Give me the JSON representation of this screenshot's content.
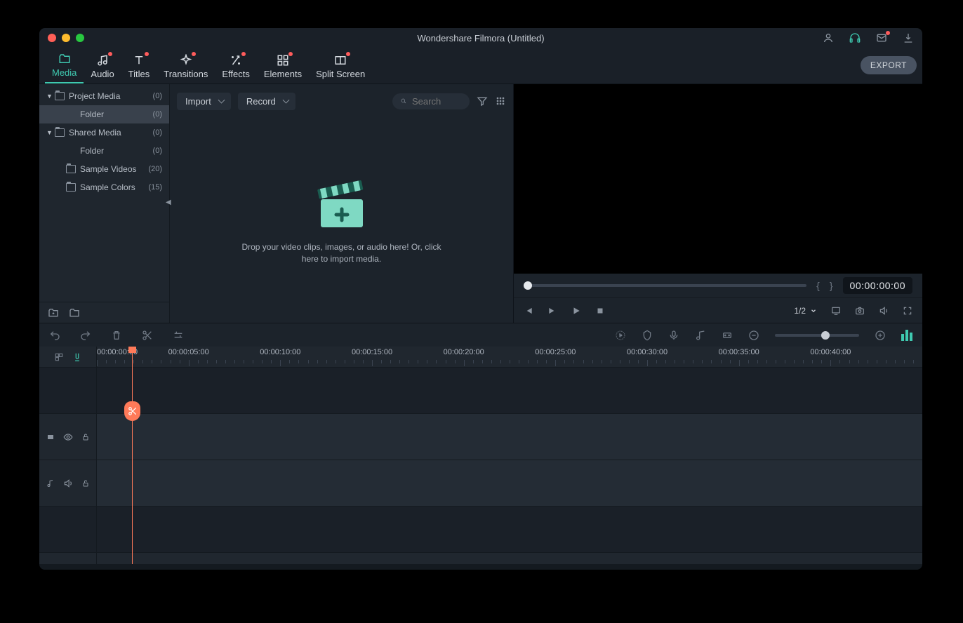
{
  "window": {
    "title": "Wondershare Filmora (Untitled)"
  },
  "toolbar": {
    "tabs": [
      {
        "label": "Media",
        "active": true,
        "dot": false
      },
      {
        "label": "Audio",
        "active": false,
        "dot": true
      },
      {
        "label": "Titles",
        "active": false,
        "dot": true
      },
      {
        "label": "Transitions",
        "active": false,
        "dot": true
      },
      {
        "label": "Effects",
        "active": false,
        "dot": true
      },
      {
        "label": "Elements",
        "active": false,
        "dot": true
      },
      {
        "label": "Split Screen",
        "active": false,
        "dot": true
      }
    ],
    "export": "EXPORT"
  },
  "sidebar": {
    "items": [
      {
        "label": "Project Media",
        "count": "(0)",
        "caret": true,
        "folder": true
      },
      {
        "label": "Folder",
        "count": "(0)",
        "selected": true,
        "indent": true
      },
      {
        "label": "Shared Media",
        "count": "(0)",
        "caret": true,
        "folder": true
      },
      {
        "label": "Folder",
        "count": "(0)",
        "indent": true
      },
      {
        "label": "Sample Videos",
        "count": "(20)",
        "folder": true,
        "indent": true
      },
      {
        "label": "Sample Colors",
        "count": "(15)",
        "folder": true,
        "indent": true
      }
    ]
  },
  "browser": {
    "import": "Import",
    "record": "Record",
    "search_placeholder": "Search",
    "dropzone": "Drop your video clips, images, or audio here! Or, click here to import media."
  },
  "preview": {
    "timecode": "00:00:00:00",
    "ratio": "1/2"
  },
  "timeline": {
    "ruler": [
      "00:00:00:00",
      "00:00:05:00",
      "00:00:10:00",
      "00:00:15:00",
      "00:00:20:00",
      "00:00:25:00",
      "00:00:30:00",
      "00:00:35:00",
      "00:00:40:00"
    ]
  }
}
